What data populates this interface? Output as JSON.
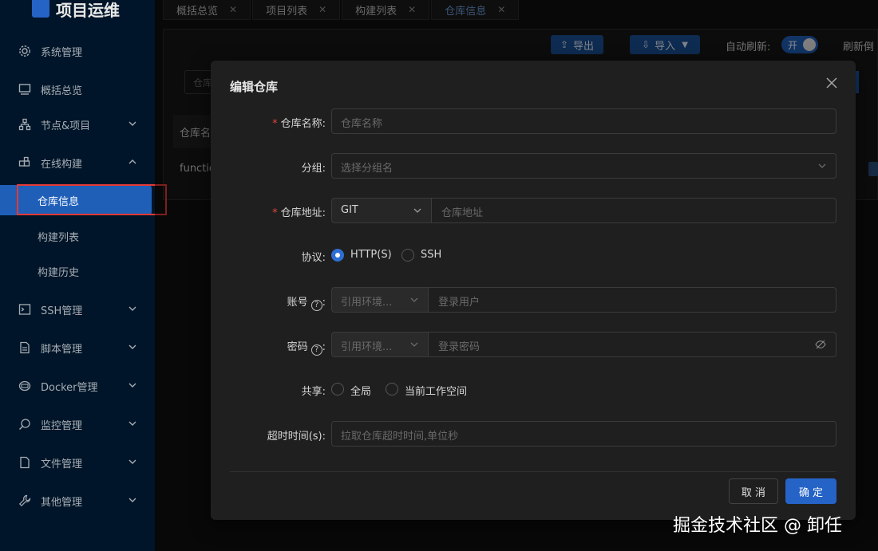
{
  "app": {
    "title": "项目运维"
  },
  "sidebar": {
    "items": [
      {
        "label": "系统管理",
        "icon": "gear-icon"
      },
      {
        "label": "概括总览",
        "icon": "monitor-icon"
      },
      {
        "label": "节点&项目",
        "icon": "cluster-icon"
      },
      {
        "label": "在线构建",
        "icon": "build-icon"
      },
      {
        "label": "SSH管理",
        "icon": "terminal-icon"
      },
      {
        "label": "脚本管理",
        "icon": "file-icon"
      },
      {
        "label": "Docker管理",
        "icon": "docker-icon"
      },
      {
        "label": "监控管理",
        "icon": "monitor-search-icon"
      },
      {
        "label": "文件管理",
        "icon": "folder-icon"
      },
      {
        "label": "其他管理",
        "icon": "wrench-icon"
      }
    ],
    "sub_items": [
      {
        "label": "仓库信息",
        "active": true
      },
      {
        "label": "构建列表"
      },
      {
        "label": "构建历史"
      }
    ]
  },
  "tabs": [
    {
      "label": "概括总览"
    },
    {
      "label": "项目列表"
    },
    {
      "label": "构建列表"
    },
    {
      "label": "仓库信息",
      "active": true
    }
  ],
  "toolbar": {
    "export_label": "导出",
    "import_label": "导入",
    "auto_refresh_label": "自动刷新:",
    "toggle_text": "开",
    "refresh_label": "刷新倒"
  },
  "background": {
    "search_placeholder": "仓库",
    "col_header": "仓库名",
    "row_value": "functio"
  },
  "modal": {
    "title": "编辑仓库",
    "fields": {
      "name": {
        "label": "仓库名称:",
        "placeholder": "仓库名称"
      },
      "group": {
        "label": "分组:",
        "placeholder": "选择分组名"
      },
      "address": {
        "label": "仓库地址:",
        "type": "GIT",
        "placeholder": "仓库地址"
      },
      "protocol": {
        "label": "协议:",
        "options": [
          "HTTP(S)",
          "SSH"
        ],
        "selected": "HTTP(S)"
      },
      "account": {
        "label": "账号",
        "env_placeholder": "引用环境...",
        "placeholder": "登录用户"
      },
      "password": {
        "label": "密码",
        "env_placeholder": "引用环境...",
        "placeholder": "登录密码"
      },
      "share": {
        "label": "共享:",
        "options": [
          "全局",
          "当前工作空间"
        ]
      },
      "timeout": {
        "label": "超时时间(s):",
        "placeholder": "拉取仓库超时时间,单位秒"
      }
    },
    "cancel_label": "取 消",
    "ok_label": "确 定"
  },
  "watermark": "掘金技术社区 @ 卸任",
  "colors": {
    "sidebar_bg": "#001529",
    "accent": "#2563c7",
    "danger": "#e53935"
  }
}
